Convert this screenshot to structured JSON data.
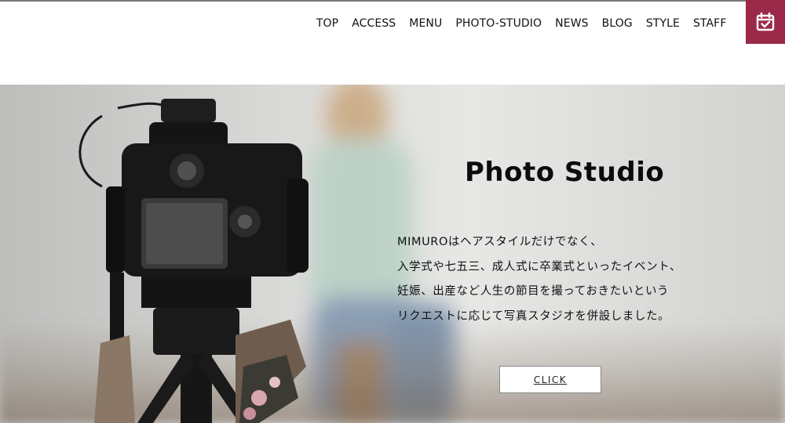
{
  "nav": {
    "items": [
      "TOP",
      "ACCESS",
      "MENU",
      "PHOTO-STUDIO",
      "NEWS",
      "BLOG",
      "STYLE",
      "STAFF"
    ]
  },
  "reserve": {
    "icon": "calendar-check-icon",
    "color": "#9b2a4a"
  },
  "hero": {
    "title": "Photo Studio",
    "lines": [
      "MIMUROはヘアスタイルだけでなく、",
      "入学式や七五三、成人式に卒業式といったイベント、",
      "妊娠、出産など人生の節目を撮っておきたいという",
      "リクエストに応じて写真スタジオを併設しました。"
    ],
    "button_label": "CLICK"
  }
}
